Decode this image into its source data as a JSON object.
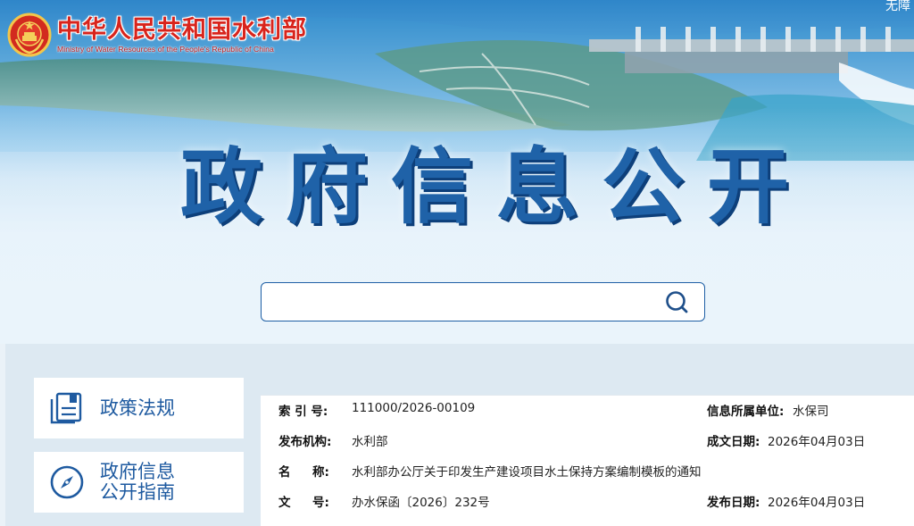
{
  "header": {
    "logo_cn": "中华人民共和国水利部",
    "logo_en": "Ministry of Water Resources of the People's Republic of China",
    "top_right_text": "无障",
    "page_title": "政府信息公开"
  },
  "search": {
    "value": "",
    "placeholder": "",
    "icon": "search-icon"
  },
  "sidebar": {
    "items": [
      {
        "label": "政策法规",
        "icon": "document-list-icon"
      },
      {
        "label_line1": "政府信息",
        "label_line2": "公开指南",
        "icon": "compass-icon"
      }
    ]
  },
  "info": {
    "index_label": "索 引 号:",
    "index_value": "111000/2026-00109",
    "unit_label": "信息所属单位:",
    "unit_value": "水保司",
    "publisher_label": "发布机构:",
    "publisher_value": "水利部",
    "created_label": "成文日期:",
    "created_value": "2026年04月03日",
    "name_label_1": "名",
    "name_label_2": "称:",
    "name_value": "水利部办公厅关于印发生产建设项目水土保持方案编制模板的通知",
    "doc_label_1": "文",
    "doc_label_2": "号:",
    "doc_value": "办水保函〔2026〕232号",
    "published_label": "发布日期:",
    "published_value": "2026年04月03日"
  },
  "colors": {
    "brand_red": "#d8241c",
    "title_blue": "#1f62a8",
    "sidebar_text": "#1e5aa0"
  }
}
